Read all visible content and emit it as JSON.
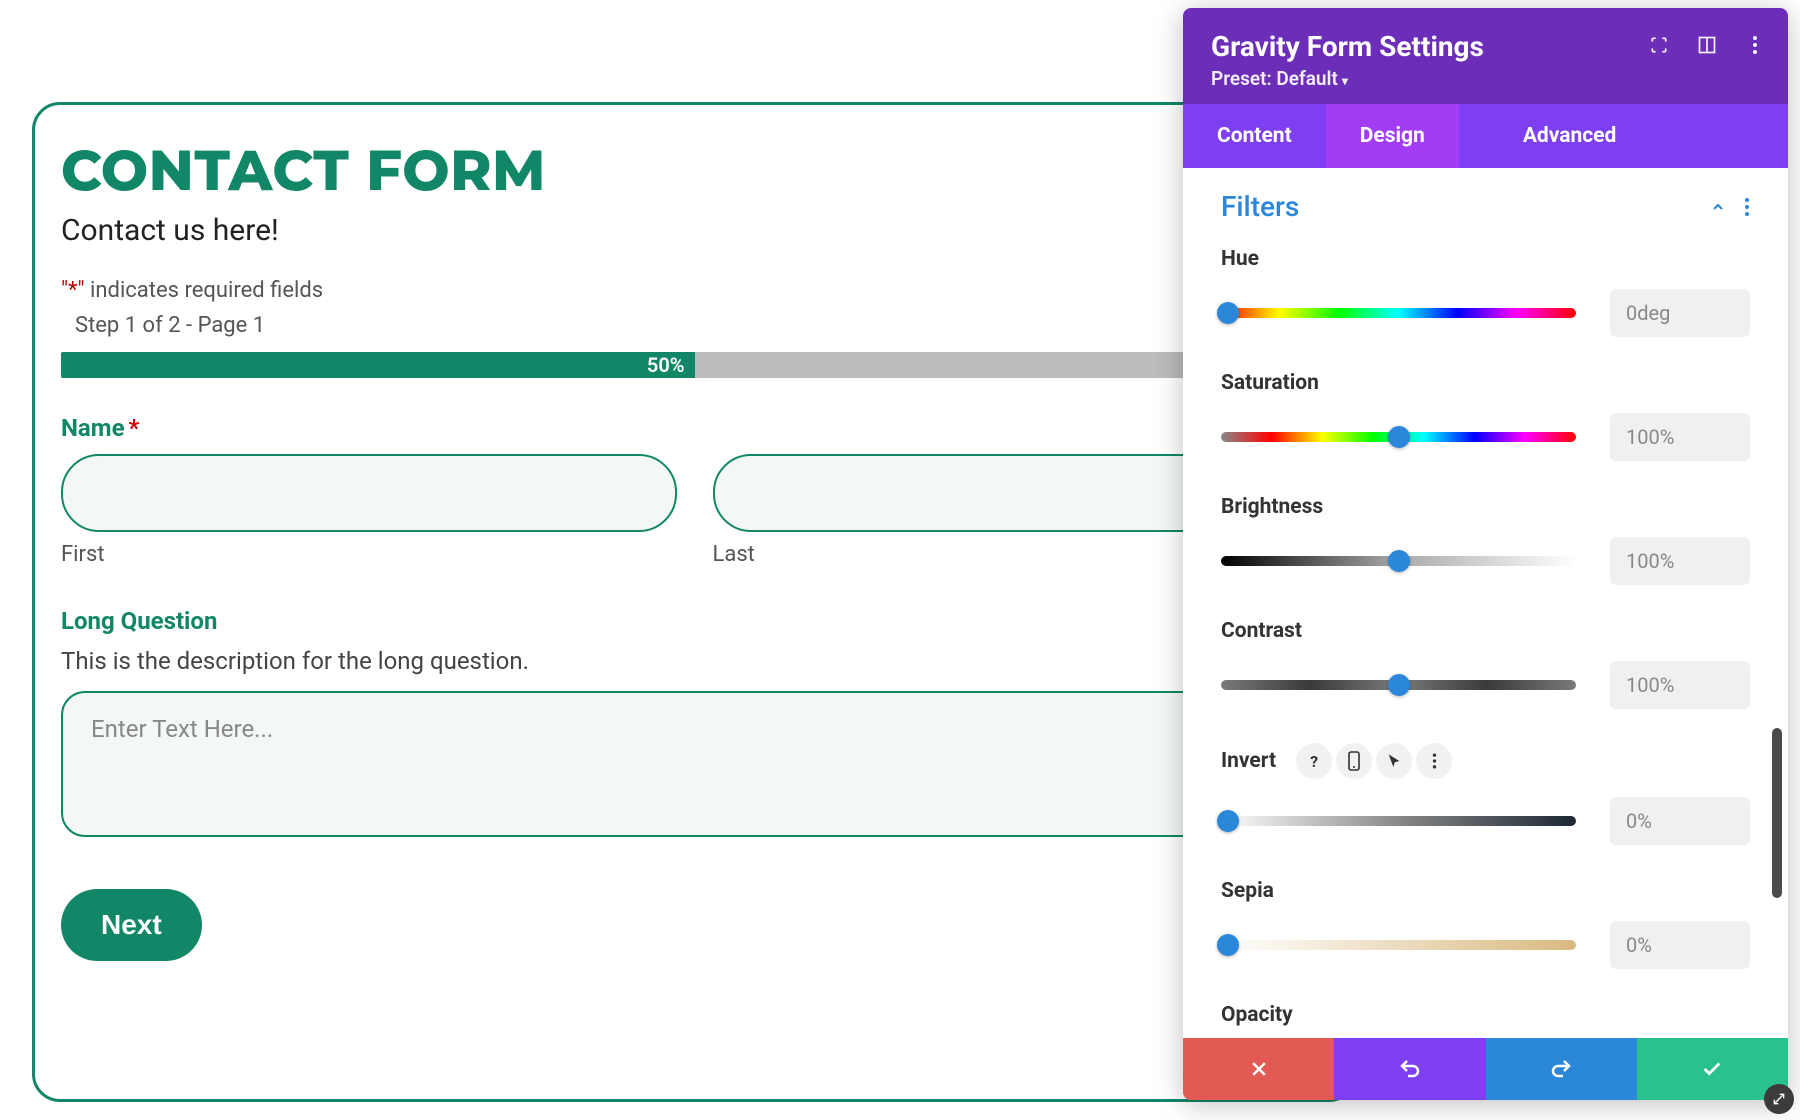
{
  "form": {
    "title": "CONTACT FORM",
    "subtitle": "Contact us here!",
    "required_note_prefix": "\"",
    "required_note_asterisk": "*",
    "required_note_suffix": "\"",
    "required_note_text": " indicates required fields",
    "step_label": "Step 1 of 2 - Page 1",
    "progress_text": "50%",
    "name_label": "Name",
    "first_sub": "First",
    "last_sub": "Last",
    "long_q_label": "Long Question",
    "long_q_desc": "This is the description for the long question.",
    "long_q_placeholder": "Enter Text Here...",
    "next_label": "Next"
  },
  "panel": {
    "title": "Gravity Form Settings",
    "preset_label": "Preset: Default",
    "tabs": {
      "content": "Content",
      "design": "Design",
      "advanced": "Advanced"
    },
    "section_title": "Filters",
    "filters": {
      "hue": {
        "label": "Hue",
        "value": "0deg",
        "pos": 0
      },
      "saturation": {
        "label": "Saturation",
        "value": "100%",
        "pos": 50
      },
      "brightness": {
        "label": "Brightness",
        "value": "100%",
        "pos": 50
      },
      "contrast": {
        "label": "Contrast",
        "value": "100%",
        "pos": 50
      },
      "invert": {
        "label": "Invert",
        "value": "0%",
        "pos": 0
      },
      "sepia": {
        "label": "Sepia",
        "value": "0%",
        "pos": 0
      },
      "opacity": {
        "label": "Opacity"
      }
    }
  }
}
